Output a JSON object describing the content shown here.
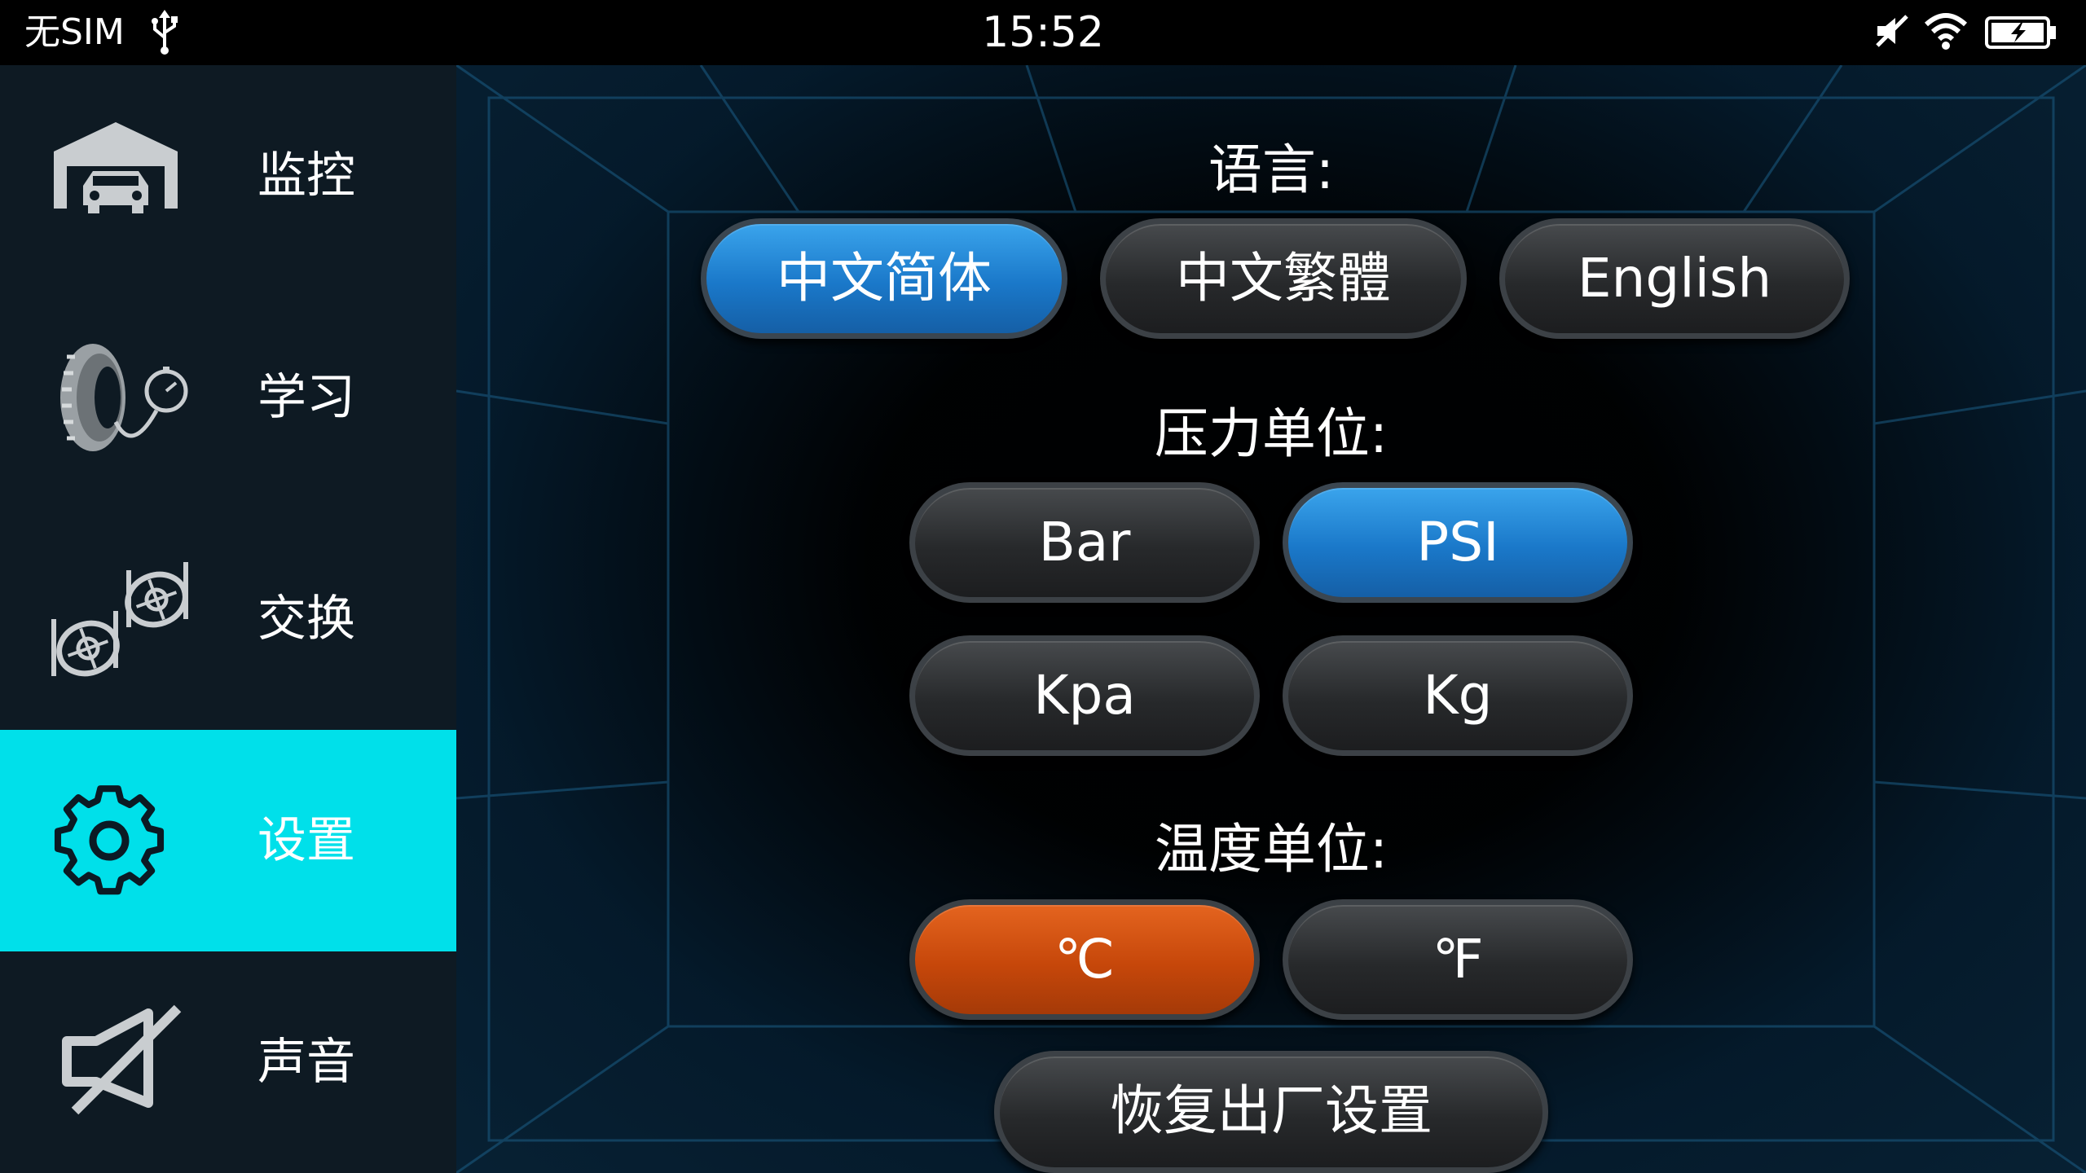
{
  "status_bar": {
    "carrier": "无SIM",
    "time": "15:52",
    "icons": [
      "usb-icon",
      "mute-icon",
      "wifi-icon",
      "battery-charging-icon"
    ]
  },
  "sidebar": {
    "items": [
      {
        "label": "监控",
        "icon": "garage-car-icon",
        "active": false
      },
      {
        "label": "学习",
        "icon": "tire-gauge-icon",
        "active": false
      },
      {
        "label": "交换",
        "icon": "tire-swap-icon",
        "active": false
      },
      {
        "label": "设置",
        "icon": "gear-icon",
        "active": true
      },
      {
        "label": "声音",
        "icon": "speaker-muted-icon",
        "active": false
      }
    ]
  },
  "settings": {
    "language": {
      "title": "语言:",
      "options": [
        "中文简体",
        "中文繁體",
        "English"
      ],
      "selected": "中文简体"
    },
    "pressure_unit": {
      "title": "压力单位:",
      "options": [
        "Bar",
        "PSI",
        "Kpa",
        "Kg"
      ],
      "selected": "PSI"
    },
    "temperature_unit": {
      "title": "温度单位:",
      "options": [
        "℃",
        "℉"
      ],
      "selected": "℃"
    },
    "reset_label": "恢复出厂设置"
  },
  "colors": {
    "accent_active_nav": "#00e0ea",
    "selected_blue": "#1a78c9",
    "selected_orange": "#c6470a",
    "sidebar_bg": "#0e1a23"
  }
}
